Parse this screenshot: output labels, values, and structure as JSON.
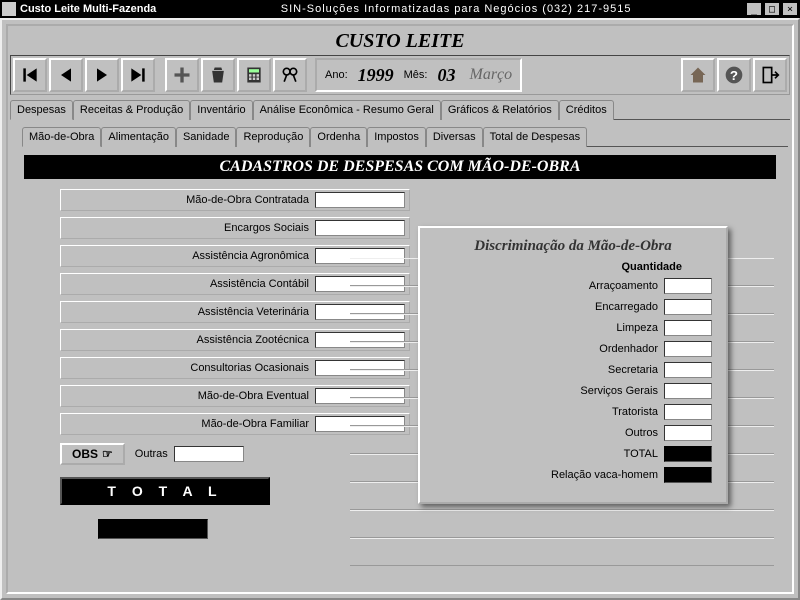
{
  "titlebar": {
    "app": "Custo Leite Multi-Fazenda",
    "brand": "SIN-Soluções Informatizadas para Negócios  (032) 217-9515",
    "min": "_",
    "max": "□",
    "close": "×"
  },
  "main_title": "CUSTO LEITE",
  "date": {
    "year_label": "Ano:",
    "year": "1999",
    "month_label": "Mês:",
    "month_num": "03",
    "month_name": "Março"
  },
  "tabs": {
    "items": [
      "Despesas",
      "Receitas & Produção",
      "Inventário",
      "Análise Econômica - Resumo Geral",
      "Gráficos & Relatórios",
      "Créditos"
    ],
    "active": 0
  },
  "subtabs": {
    "items": [
      "Mão-de-Obra",
      "Alimentação",
      "Sanidade",
      "Reprodução",
      "Ordenha",
      "Impostos",
      "Diversas",
      "Total de Despesas"
    ],
    "active": 0
  },
  "section_header": "CADASTROS DE DESPESAS COM MÃO-DE-OBRA",
  "fields": [
    "Mão-de-Obra Contratada",
    "Encargos Sociais",
    "Assistência Agronômica",
    "Assistência Contábil",
    "Assistência Veterinária",
    "Assistência Zootécnica",
    "Consultorias Ocasionais",
    "Mão-de-Obra Eventual",
    "Mão-de-Obra Familiar"
  ],
  "obs_label": "OBS",
  "outras_label": "Outras",
  "total_label": "T O T A L",
  "panel": {
    "title": "Discriminação da Mão-de-Obra",
    "sub": "Quantidade",
    "rows": [
      "Arraçoamento",
      "Encarregado",
      "Limpeza",
      "Ordenhador",
      "Secretaria",
      "Serviços Gerais",
      "Tratorista",
      "Outros"
    ],
    "total": "TOTAL",
    "ratio": "Relação vaca-homem"
  }
}
